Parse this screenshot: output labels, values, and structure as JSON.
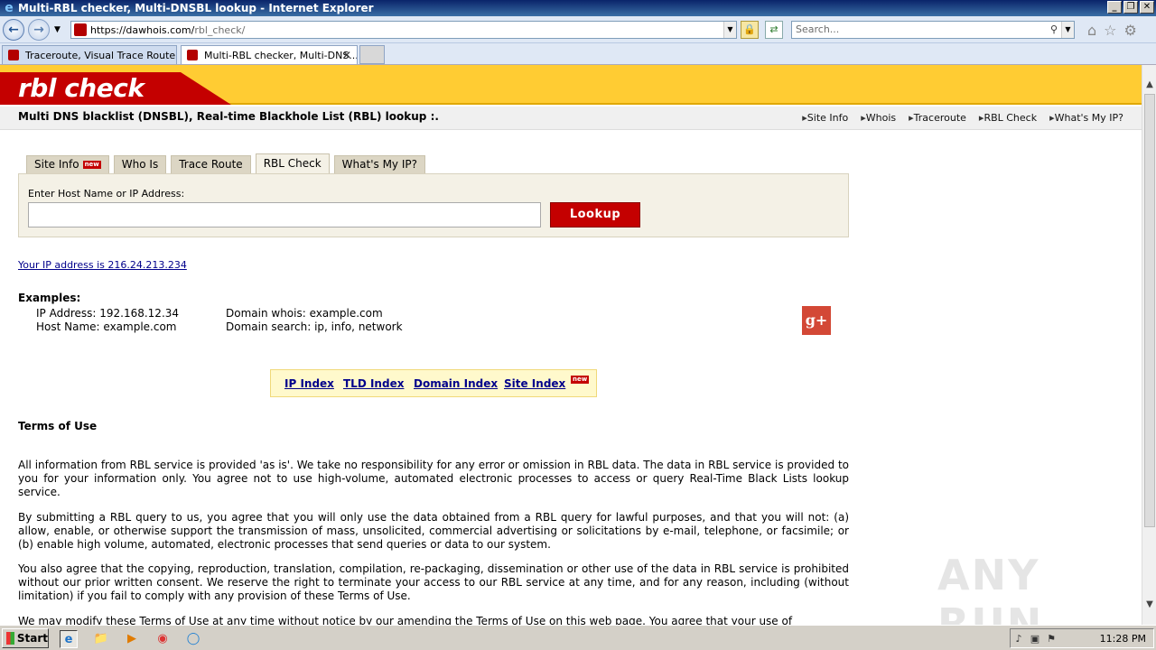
{
  "window": {
    "title": "Multi-RBL checker, Multi-DNSBL lookup - Internet Explorer",
    "controls": [
      "_",
      "❐",
      "✕"
    ]
  },
  "addressbar": {
    "url_host": "https://dawhois.com/",
    "url_path": "rbl_check/",
    "search_placeholder": "Search..."
  },
  "tabs": [
    {
      "label": "Traceroute, Visual Trace Route,...",
      "active": false
    },
    {
      "label": "Multi-RBL checker, Multi-DNS...",
      "active": true
    }
  ],
  "site": {
    "logo": "rbl check",
    "subtitle": "Multi DNS blacklist (DNSBL), Real-time Blackhole List (RBL) lookup :.",
    "top_links": [
      "Site Info",
      "Whois",
      "Traceroute",
      "RBL Check",
      "What's My IP?"
    ],
    "nav_tabs": [
      {
        "label": "Site Info",
        "badge": "new"
      },
      {
        "label": "Who Is",
        "badge": ""
      },
      {
        "label": "Trace Route",
        "badge": ""
      },
      {
        "label": "RBL Check",
        "badge": ""
      },
      {
        "label": "What's My IP?",
        "badge": ""
      }
    ],
    "lookup_label": "Enter Host Name or IP Address:",
    "lookup_value": "",
    "lookup_button": "Lookup",
    "ip_line": "Your IP address is 216.24.213.234",
    "examples_title": "Examples:",
    "examples_left": [
      "IP Address: 192.168.12.34",
      "Host Name: example.com"
    ],
    "examples_right": [
      "Domain whois: example.com",
      "Domain search: ip, info, network"
    ],
    "gplus": "g+",
    "index_links": [
      "IP Index",
      "TLD Index",
      "Domain Index",
      "Site Index"
    ],
    "index_badge": "new",
    "terms_title": "Terms of Use",
    "terms_paragraphs": [
      "All information from RBL service is provided 'as is'. We take no responsibility for any error or omission in RBL data. The data in RBL service is provided to you for your information only. You agree not to use high-volume, automated electronic processes to access or query Real-Time Black Lists lookup service.",
      "By submitting a RBL query to us, you agree that you will only use the data obtained from a RBL query for lawful purposes, and that you will not: (a) allow, enable, or otherwise support the transmission of mass, unsolicited, commercial advertising or solicitations by e-mail, telephone, or facsimile; or (b) enable high volume, automated, electronic processes that send queries or data to our system.",
      "You also agree that the copying, reproduction, translation, compilation, re-packaging, dissemination or other use of the data in RBL service is prohibited without our prior written consent. We reserve the right to terminate your access to our RBL service at any time, and for any reason, including (without limitation) if you fail to comply with any provision of these Terms of Use.",
      "We may modify these Terms of Use at any time without notice by our amending the Terms of Use on this web page. You agree that your use of"
    ]
  },
  "watermark": "ANY RUN",
  "taskbar": {
    "start_label": "Start",
    "clock": "11:28 PM"
  },
  "colors": {
    "brand_red": "#c40000",
    "brand_yellow": "#ffcc33",
    "link_blue": "#00008b"
  }
}
